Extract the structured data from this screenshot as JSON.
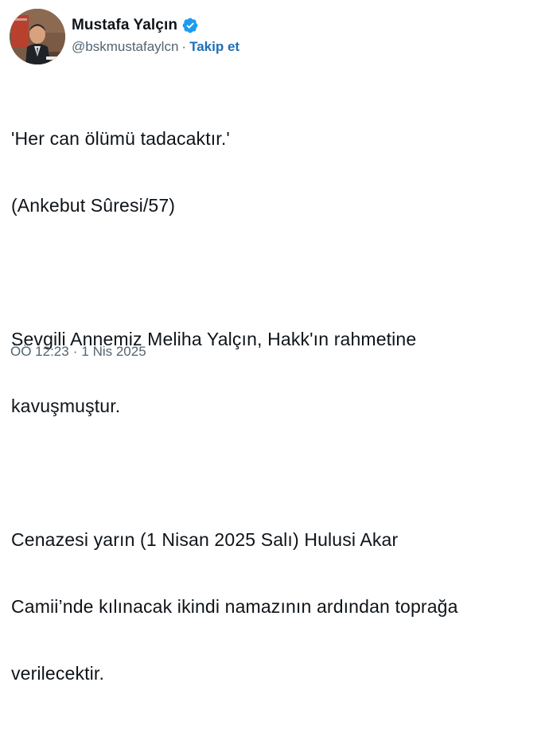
{
  "author": {
    "display_name": "Mustafa Yalçın",
    "handle": "@bskmustafaylcn",
    "separator": "·",
    "follow_label": "Takip et",
    "verified_icon": "verified-badge-icon",
    "verified_color": "#1d9bf0"
  },
  "tweet": {
    "lines": [
      "'Her can ölümü tadacaktır.'",
      "(Ankebut Sûresi/57)",
      "",
      "Sevgili Annemiz Meliha Yalçın, Hakk'ın rahmetine",
      "kavuşmuştur.",
      "",
      "Cenazesi yarın (1 Nisan 2025 Salı) Hulusi Akar",
      "Camii’nde kılınacak ikindi namazının ardından toprağa",
      "verilecektir."
    ]
  },
  "meta": {
    "time": "ÖÖ 12:23",
    "separator": "·",
    "date": "1 Nis 2025"
  },
  "colors": {
    "text": "#0f1419",
    "secondary": "#536471",
    "link": "#1d6fb8"
  }
}
